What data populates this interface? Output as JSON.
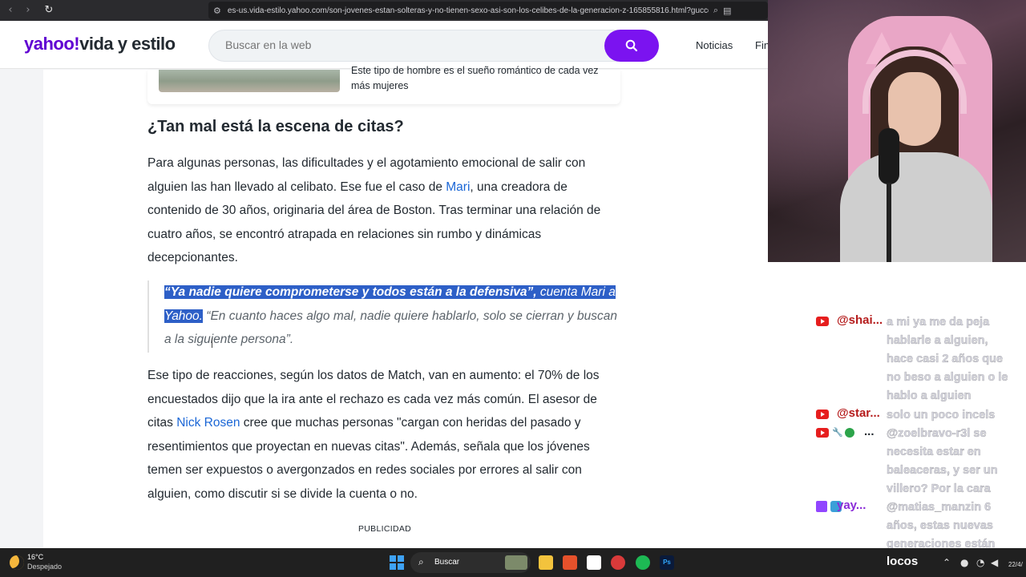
{
  "browser": {
    "url": "es-us.vida-estilo.yahoo.com/son-jovenes-estan-solteras-y-no-tienen-sexo-asi-son-los-celibes-de-la-generacion-z-165855816.html?gucco..."
  },
  "header": {
    "logo_brand": "yahoo!",
    "logo_section": "vida y estilo",
    "search_placeholder": "Buscar en la web",
    "nav": [
      "Noticias",
      "Fin"
    ]
  },
  "related": {
    "text": "Este tipo de hombre es el sueño romántico de cada vez más mujeres"
  },
  "article": {
    "heading": "¿Tan mal está la escena de citas?",
    "p1_a": "Para algunas personas, las dificultades y el agotamiento emocional de salir con alguien las han llevado al celibato. Ese fue el caso de ",
    "p1_link": "Mari",
    "p1_b": ", una creadora de contenido de 30 años, originaria del área de Boston. Tras terminar una relación de cuatro años, se encontró atrapada en relaciones sin rumbo y dinámicas decepcionantes.",
    "quote_bold": "“Ya nadie quiere comprometerse y todos están a la defensiva”,",
    "quote_hl_rest": " cuenta Mari a Yahoo.",
    "quote_rest": " “En cuanto haces algo mal, nadie quiere hablarlo, solo se cierran y buscan a la siguiente persona”.",
    "p2_a": "Ese tipo de reacciones, según los datos de Match, van en aumento: el 70% de los encuestados dijo que la ira ante el rechazo es cada vez más común. El asesor de citas ",
    "p2_link": "Nick Rosen",
    "p2_b": " cree que muchas personas \"cargan con heridas del pasado y resentimientos que proyectan en nuevas citas\". Además, señala que los jóvenes temen ser expuestos o avergonzados en redes sociales por errores al salir con alguien, como discutir si se divide la cuenta o no.",
    "ad_label": "PUBLICIDAD"
  },
  "chat": [
    {
      "user": "@shai...",
      "msg": "a mi ya me da peja hablarle a alguien, hace casi 2 años que no beso a alguien o le hablo a alguien",
      "platform": "youtube"
    },
    {
      "user": "@star...",
      "msg": "solo un poco incels",
      "platform": "youtube"
    },
    {
      "user": "...",
      "msg": "@zoelbravo-r3l se necesita estar en baleaceras, y ser un villero? Por la cara",
      "platform": "youtube"
    },
    {
      "user": "yay...",
      "msg": "@matias_manzin 6 años, estas nuevas generaciones están",
      "platform": "twitch"
    }
  ],
  "taskbar": {
    "weather_temp": "16°C",
    "weather_desc": "Despejado",
    "search_label": "Buscar",
    "tray_text": "locos",
    "clock_partial": "22/4/"
  }
}
